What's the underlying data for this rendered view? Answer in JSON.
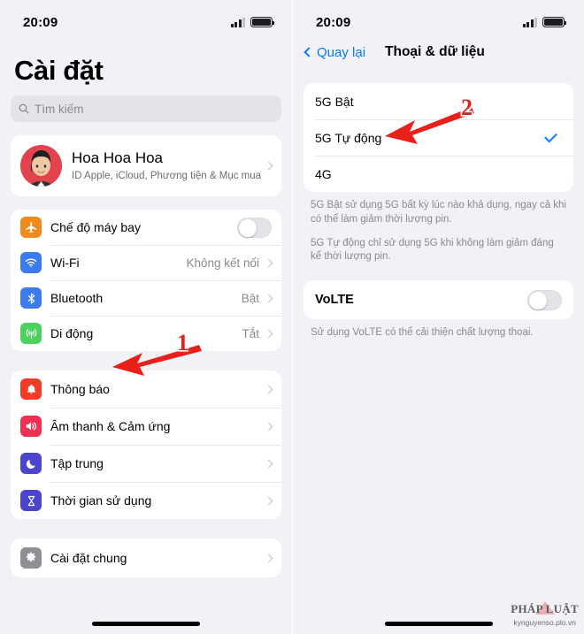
{
  "statusbar": {
    "time": "20:09",
    "signal_icon": "signal-bars-icon",
    "battery_icon": "battery-full-icon"
  },
  "left": {
    "title": "Cài đặt",
    "search": {
      "placeholder": "Tìm kiếm",
      "icon": "search-icon"
    },
    "profile": {
      "name": "Hoa Hoa Hoa",
      "subtitle": "ID Apple, iCloud, Phương tiện & Mục mua",
      "avatar": "user-avatar"
    },
    "group_connectivity": [
      {
        "label": "Chế độ máy bay",
        "value": "",
        "icon": "airplane-icon",
        "color": "#f08a1e",
        "control": "toggle",
        "on": false
      },
      {
        "label": "Wi-Fi",
        "value": "Không kết nối",
        "icon": "wifi-icon",
        "color": "#3a7bf0",
        "control": "chevron"
      },
      {
        "label": "Bluetooth",
        "value": "Bật",
        "icon": "bluetooth-icon",
        "color": "#3a7bf0",
        "control": "chevron"
      },
      {
        "label": "Di động",
        "value": "Tắt",
        "icon": "cellular-icon",
        "color": "#4cd15f",
        "control": "chevron"
      }
    ],
    "group_notifications": [
      {
        "label": "Thông báo",
        "icon": "bell-icon",
        "color": "#f03c26"
      },
      {
        "label": "Âm thanh & Cảm ứng",
        "icon": "speaker-icon",
        "color": "#f03050"
      },
      {
        "label": "Tập trung",
        "icon": "moon-icon",
        "color": "#4a44cf"
      },
      {
        "label": "Thời gian sử dụng",
        "icon": "hourglass-icon",
        "color": "#4a44cf"
      }
    ],
    "group_general": [
      {
        "label": "Cài đặt chung",
        "icon": "gear-icon",
        "color": "#8e8e93"
      }
    ]
  },
  "right": {
    "back_label": "Quay lại",
    "back_icon": "chevron-left-icon",
    "title": "Thoại & dữ liệu",
    "options": [
      {
        "label": "5G Bật",
        "selected": false
      },
      {
        "label": "5G Tự động",
        "selected": true
      },
      {
        "label": "4G",
        "selected": false
      }
    ],
    "footnote_1": "5G Bật sử dụng 5G bất kỳ lúc nào khả dụng, ngay cả khi có thể làm giảm thời lượng pin.",
    "footnote_2": "5G Tự động chỉ sử dụng 5G khi không làm giảm đáng kể thời lượng pin.",
    "volte": {
      "label": "VoLTE",
      "on": false
    },
    "volte_footnote": "Sử dụng VoLTE có thể cải thiện chất lượng thoại."
  },
  "annotations": [
    {
      "number": "1",
      "color": "#e8201a",
      "target": "Di động"
    },
    {
      "number": "2",
      "color": "#e8201a",
      "target": "5G Tự động"
    }
  ],
  "watermark": {
    "logo": "PHÁP LUẬT",
    "url": "kynguyenso.plo.vn"
  }
}
